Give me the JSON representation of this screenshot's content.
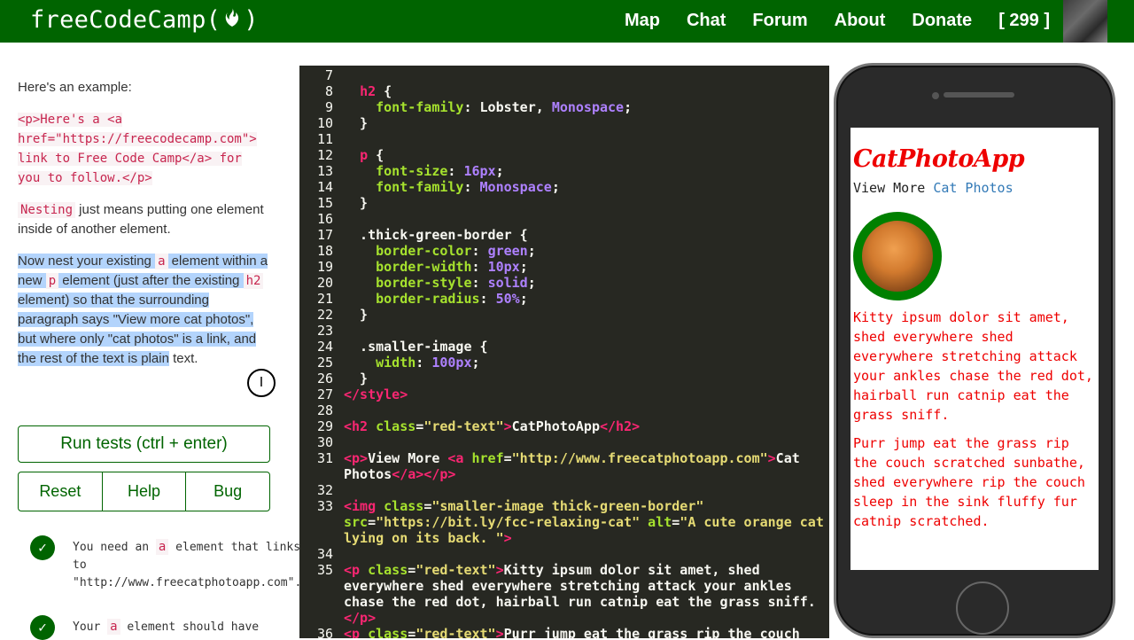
{
  "nav": {
    "logo_text_left": "freeCodeCamp(",
    "logo_text_right": ")",
    "links": [
      "Map",
      "Chat",
      "Forum",
      "About",
      "Donate"
    ],
    "points": "[ 299 ]"
  },
  "lesson": {
    "example_intro": "Here's an example:",
    "example_code": [
      "<p>Here's a <a",
      "href=\"https://freecodecamp.com\">",
      "link to Free Code Camp</a> for",
      "you to follow.</p>"
    ],
    "nesting_term": "Nesting",
    "nesting_rest": " just means putting one element inside of another element.",
    "instr_1": "Now nest your existing ",
    "instr_a": "a",
    "instr_2": " element within a new ",
    "instr_p": "p",
    "instr_3": " element (just after the existing ",
    "instr_h2": "h2",
    "instr_4": " element) so that the surrounding paragraph says \"View more cat photos\", but where only \"cat photos\" is a link, and the rest of the text is plain",
    "instr_5": " text."
  },
  "buttons": {
    "run": "Run tests (ctrl + enter)",
    "reset": "Reset",
    "help": "Help",
    "bug": "Bug"
  },
  "tests": [
    {
      "pre": "You need an ",
      "code": "a",
      "post": " element that links to \"http://www.freecatphotoapp.com\"."
    },
    {
      "pre": "Your ",
      "code": "a",
      "post": " element should have"
    }
  ],
  "preview": {
    "title": "CatPhotoApp",
    "view_more": "View More ",
    "link": "Cat Photos",
    "para1": "Kitty ipsum dolor sit amet, shed everywhere shed everywhere stretching attack your ankles chase the red dot, hairball run catnip eat the grass sniff.",
    "para2": "Purr jump eat the grass rip the couch scratched sunbathe, shed everywhere rip the couch sleep in the sink fluffy fur catnip scratched."
  }
}
